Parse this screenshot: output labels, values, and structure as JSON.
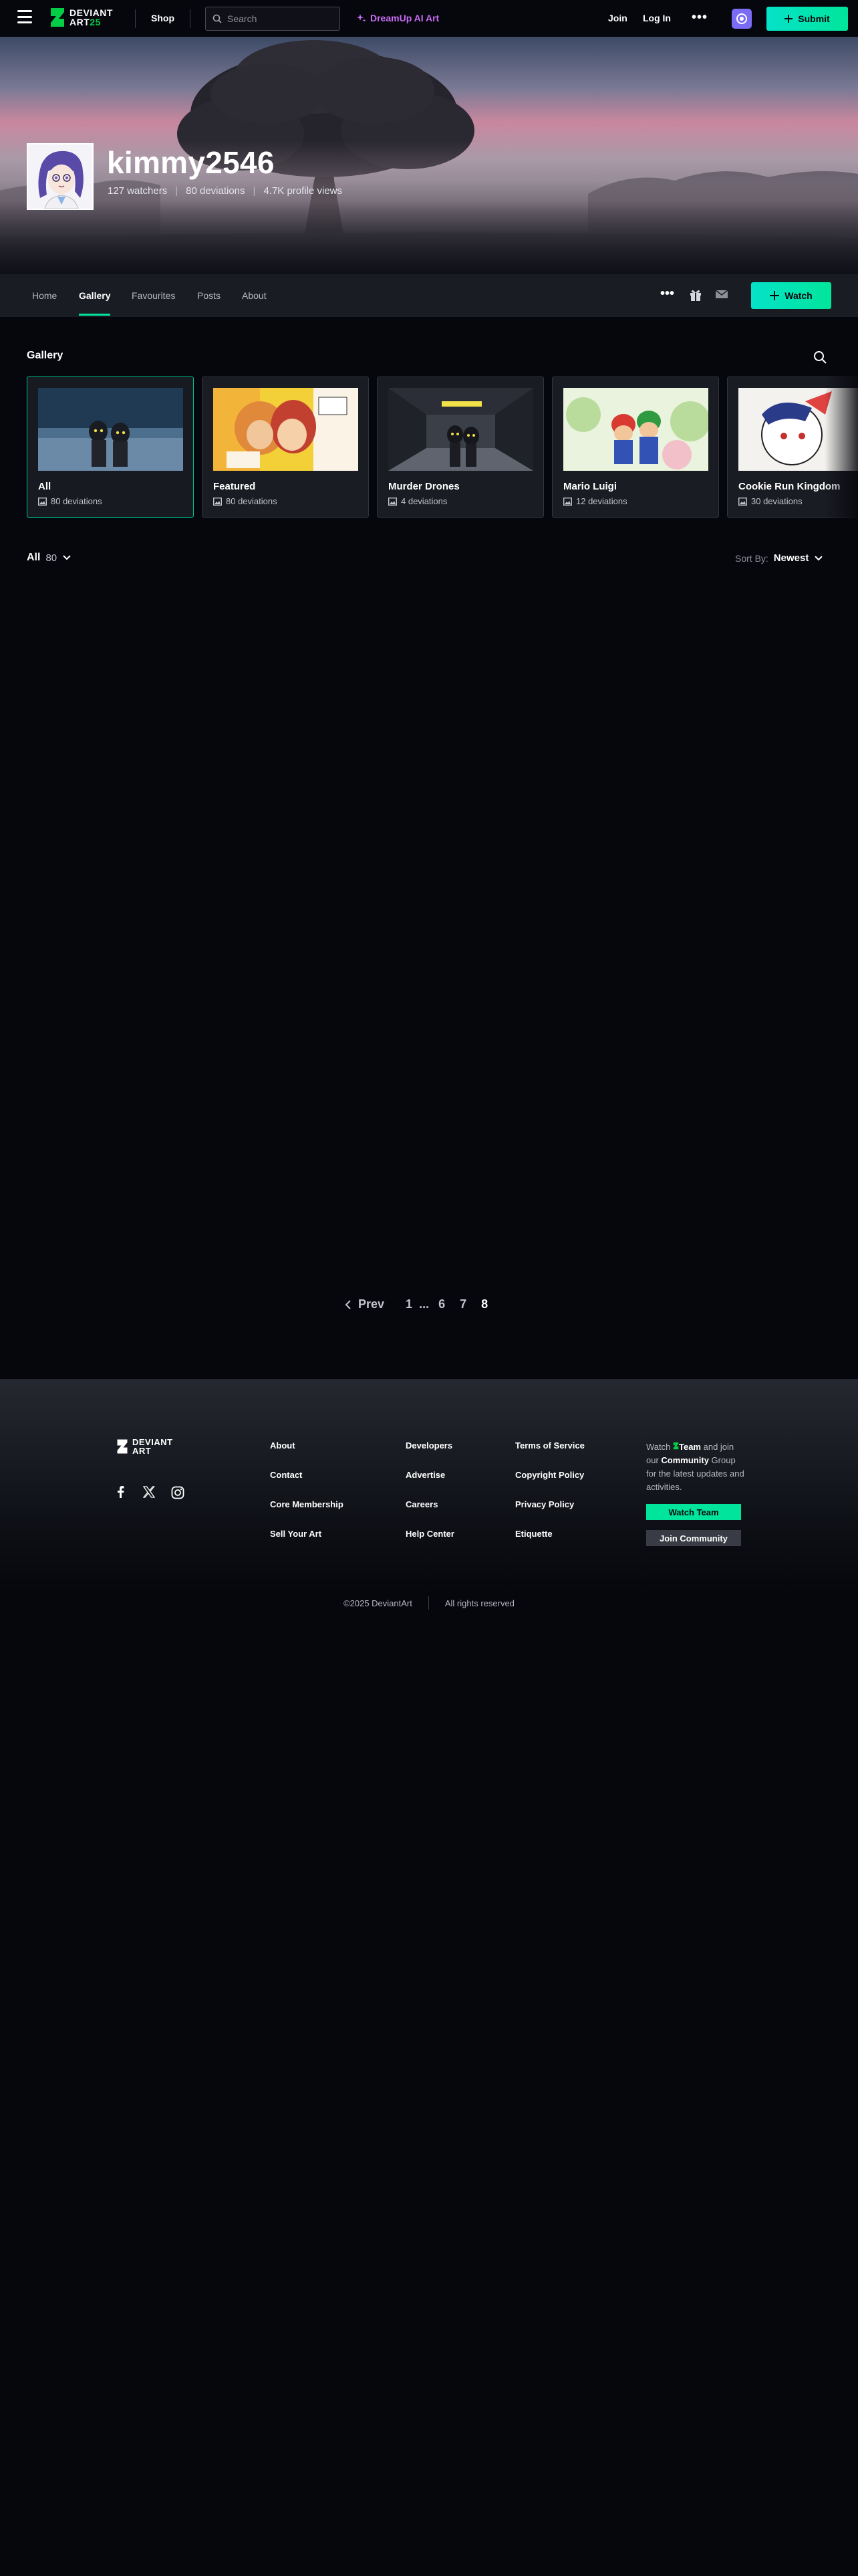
{
  "topnav": {
    "logo_line1": "DEVIANT",
    "logo_line2": "ART",
    "logo_line2_highlight": "25",
    "shop": "Shop",
    "search_placeholder": "Search",
    "dreamup": "DreamUp AI Art",
    "join": "Join",
    "login": "Log In",
    "submit": "Submit"
  },
  "profile": {
    "username": "kimmy2546",
    "watchers": "127 watchers",
    "deviations": "80 deviations",
    "profile_views": "4.7K profile views"
  },
  "tabs": [
    {
      "label": "Home",
      "active": false
    },
    {
      "label": "Gallery",
      "active": true
    },
    {
      "label": "Favourites",
      "active": false
    },
    {
      "label": "Posts",
      "active": false
    },
    {
      "label": "About",
      "active": false
    }
  ],
  "watch_button": "Watch",
  "gallery": {
    "title": "Gallery",
    "folders": [
      {
        "name": "All",
        "count": "80 deviations",
        "selected": true
      },
      {
        "name": "Featured",
        "count": "80 deviations",
        "selected": false
      },
      {
        "name": "Murder Drones",
        "count": "4 deviations",
        "selected": false
      },
      {
        "name": "Mario Luigi",
        "count": "12 deviations",
        "selected": false
      },
      {
        "name": "Cookie Run Kingdom",
        "count": "30 deviations",
        "selected": false
      }
    ],
    "filter_label": "All",
    "filter_count": "80",
    "sort_label": "Sort By:",
    "sort_value": "Newest"
  },
  "pagination": {
    "prev": "Prev",
    "pages": [
      "1",
      "...",
      "6",
      "7",
      "8"
    ],
    "current": "8"
  },
  "footer": {
    "logo_line1": "DEVIANT",
    "logo_line2": "ART",
    "col1": [
      "About",
      "Contact",
      "Core Membership",
      "Sell Your Art"
    ],
    "col2": [
      "Developers",
      "Advertise",
      "Careers",
      "Help Center"
    ],
    "col3": [
      "Terms of Service",
      "Copyright Policy",
      "Privacy Policy",
      "Etiquette"
    ],
    "community_watch": "Watch",
    "community_team": "Team",
    "community_and": "and join our",
    "community_community": "Community",
    "community_rest": "Group for the latest updates and activities.",
    "watch_team": "Watch Team",
    "join_community": "Join Community",
    "copyright": "©2025 DeviantArt",
    "rights": "All rights reserved"
  },
  "colors": {
    "accent": "#00e59b",
    "background": "#06070d",
    "dreamup": "#c86cf5",
    "core_badge": "#7a6cf5"
  }
}
